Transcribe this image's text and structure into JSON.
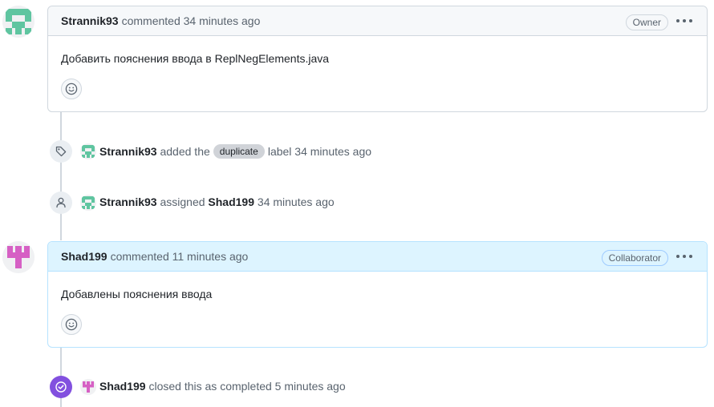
{
  "comments": [
    {
      "author": "Strannik93",
      "meta": "commented 34 minutes ago",
      "role": "Owner",
      "body": "Добавить пояснения ввода в ReplNegElements.java"
    },
    {
      "author": "Shad199",
      "meta": "commented 11 minutes ago",
      "role": "Collaborator",
      "body": "Добавлены пояснения ввода"
    }
  ],
  "events": {
    "label_event": {
      "actor": "Strannik93",
      "action": "added the",
      "label": "duplicate",
      "suffix": "label 34 minutes ago"
    },
    "assign_event": {
      "actor": "Strannik93",
      "action": "assigned",
      "target": "Shad199",
      "time": "34 minutes ago"
    },
    "close_event": {
      "actor": "Shad199",
      "action": "closed this as completed 5 minutes ago"
    }
  },
  "colors": {
    "strannik_avatar": "#5fc5a0",
    "shad_avatar": "#d660c4",
    "closed_purple": "#8250df",
    "highlight_header": "#ddf4ff"
  },
  "icons": {
    "label_event": "tag-icon",
    "assign_event": "person-icon",
    "close_event": "check-circle-icon",
    "reaction": "smiley-icon",
    "menu": "kebab-horizontal-icon"
  }
}
